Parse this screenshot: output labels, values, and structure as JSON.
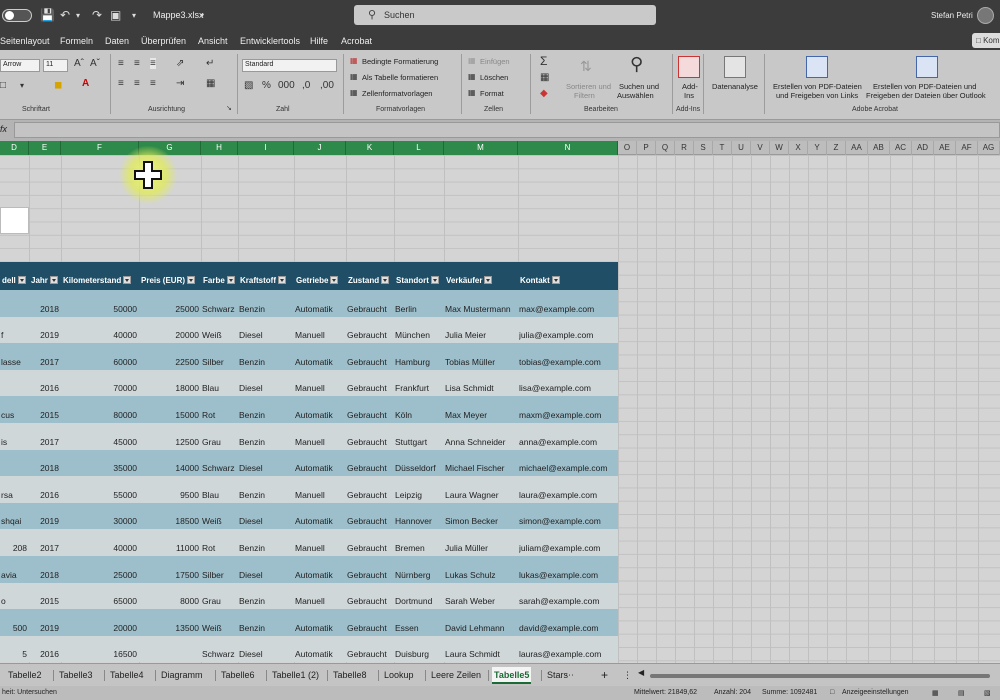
{
  "titlebar": {
    "filename": "Mappe3.xlsx",
    "search_placeholder": "Suchen",
    "user": "Stefan Petri"
  },
  "menu": [
    "Seitenlayout",
    "Formeln",
    "Daten",
    "Überprüfen",
    "Ansicht",
    "Entwicklertools",
    "Hilfe",
    "Acrobat"
  ],
  "komment_label": "Kom",
  "ribbon": {
    "font_name": "Arrow",
    "font_size": "11",
    "number_format": "Standard",
    "groups": [
      "Schriftart",
      "Ausrichtung",
      "Zahl",
      "Formatvorlagen",
      "Zellen",
      "Bearbeiten",
      "Add-Ins",
      "Adobe Acrobat"
    ],
    "styles": [
      "Bedingte Formatierung",
      "Als Tabelle formatieren",
      "Zellenformatvorlagen"
    ],
    "cells": [
      "Einfügen",
      "Löschen",
      "Format"
    ],
    "sort_label_1": "Sortieren und",
    "sort_label_2": "Filtern",
    "find_label_1": "Suchen und",
    "find_label_2": "Auswählen",
    "addins_1": "Add-",
    "addins_2": "Ins",
    "datenanalyse": "Datenanalyse",
    "pdf1_1": "Erstellen von PDF-Dateien",
    "pdf1_2": "und Freigeben von Links",
    "pdf2_1": "Erstellen von PDF-Dateien und",
    "pdf2_2": "Freigeben der Dateien über Outlook"
  },
  "formula": {
    "fx": "fx"
  },
  "columns": [
    "D",
    "E",
    "F",
    "G",
    "H",
    "I",
    "J",
    "K",
    "L",
    "M",
    "N",
    "O",
    "P",
    "Q",
    "R",
    "S",
    "T",
    "U",
    "V",
    "W",
    "X",
    "Y",
    "Z",
    "AA",
    "AB",
    "AC",
    "AD",
    "AE",
    "AF",
    "AG"
  ],
  "table": {
    "headers": [
      "dell",
      "Jahr",
      "Kilometerstand",
      "Preis (EUR)",
      "Farbe",
      "Kraftstoff",
      "Getriebe",
      "Zustand",
      "Standort",
      "Verkäufer",
      "Kontakt"
    ],
    "rows": [
      [
        "",
        "2018",
        "50000",
        "25000",
        "Schwarz",
        "Benzin",
        "Automatik",
        "Gebraucht",
        "Berlin",
        "Max Mustermann",
        "max@example.com"
      ],
      [
        "f",
        "2019",
        "40000",
        "20000",
        "Weiß",
        "Diesel",
        "Manuell",
        "Gebraucht",
        "München",
        "Julia Meier",
        "julia@example.com"
      ],
      [
        "lasse",
        "2017",
        "60000",
        "22500",
        "Silber",
        "Benzin",
        "Automatik",
        "Gebraucht",
        "Hamburg",
        "Tobias Müller",
        "tobias@example.com"
      ],
      [
        "",
        "2016",
        "70000",
        "18000",
        "Blau",
        "Diesel",
        "Manuell",
        "Gebraucht",
        "Frankfurt",
        "Lisa Schmidt",
        "lisa@example.com"
      ],
      [
        "cus",
        "2015",
        "80000",
        "15000",
        "Rot",
        "Benzin",
        "Automatik",
        "Gebraucht",
        "Köln",
        "Max Meyer",
        "maxm@example.com"
      ],
      [
        "is",
        "2017",
        "45000",
        "12500",
        "Grau",
        "Benzin",
        "Manuell",
        "Gebraucht",
        "Stuttgart",
        "Anna Schneider",
        "anna@example.com"
      ],
      [
        "",
        "2018",
        "35000",
        "14000",
        "Schwarz",
        "Diesel",
        "Automatik",
        "Gebraucht",
        "Düsseldorf",
        "Michael Fischer",
        "michael@example.com"
      ],
      [
        "rsa",
        "2016",
        "55000",
        "9500",
        "Blau",
        "Benzin",
        "Manuell",
        "Gebraucht",
        "Leipzig",
        "Laura Wagner",
        "laura@example.com"
      ],
      [
        "shqai",
        "2019",
        "30000",
        "18500",
        "Weiß",
        "Diesel",
        "Automatik",
        "Gebraucht",
        "Hannover",
        "Simon Becker",
        "simon@example.com"
      ],
      [
        "208",
        "2017",
        "40000",
        "11000",
        "Rot",
        "Benzin",
        "Manuell",
        "Gebraucht",
        "Bremen",
        "Julia Müller",
        "juliam@example.com"
      ],
      [
        "avia",
        "2018",
        "25000",
        "17500",
        "Silber",
        "Diesel",
        "Automatik",
        "Gebraucht",
        "Nürnberg",
        "Lukas Schulz",
        "lukas@example.com"
      ],
      [
        "o",
        "2015",
        "65000",
        "8000",
        "Grau",
        "Benzin",
        "Manuell",
        "Gebraucht",
        "Dortmund",
        "Sarah Weber",
        "sarah@example.com"
      ],
      [
        "500",
        "2019",
        "20000",
        "13500",
        "Weiß",
        "Benzin",
        "Automatik",
        "Gebraucht",
        "Essen",
        "David Lehmann",
        "david@example.com"
      ],
      [
        "5",
        "2016",
        "16500",
        "",
        "Schwarz",
        "Diesel",
        "Automatik",
        "Gebraucht",
        "Duisburg",
        "Laura Schmidt",
        "lauras@example.com"
      ]
    ]
  },
  "sheets": [
    "Tabelle2",
    "Tabelle3",
    "Tabelle4",
    "Diagramm",
    "Tabelle6",
    "Tabelle1 (2)",
    "Tabelle8",
    "Lookup",
    "Leere Zeilen",
    "Tabelle5",
    "Stars"
  ],
  "active_sheet": "Tabelle5",
  "status": {
    "left": "heit: Untersuchen",
    "mittelwert": "Mittelwert: 21849,62",
    "anzahl": "Anzahl: 204",
    "summe": "Summe: 1092481",
    "anzeige": "Anzeigeeinstellungen"
  }
}
